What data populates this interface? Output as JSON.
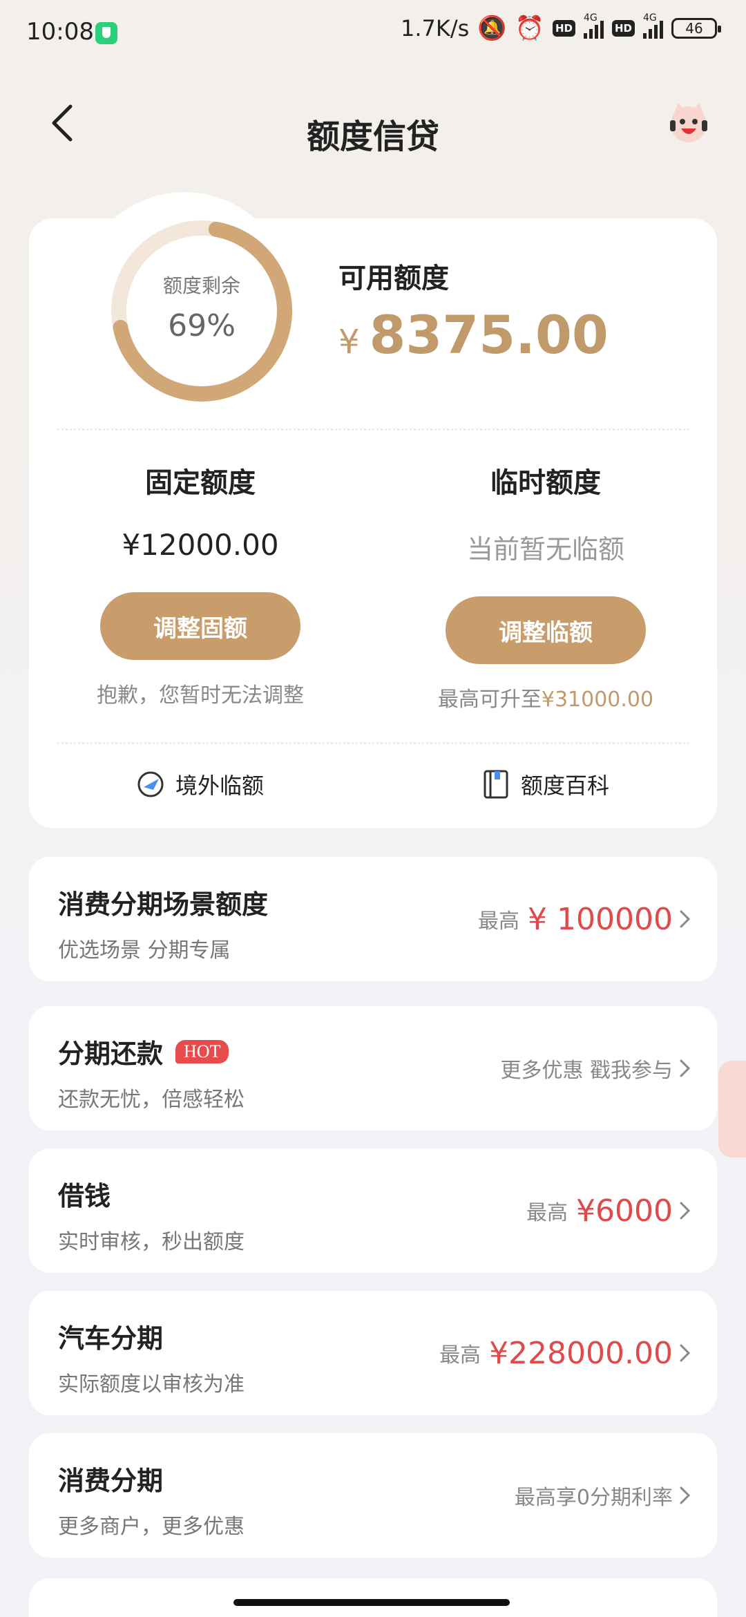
{
  "status_bar": {
    "time": "10:08",
    "net_speed": "1.7K/s",
    "hd1": "HD",
    "hd2": "HD",
    "network1": "4G",
    "network2": "4G",
    "battery": "46"
  },
  "header": {
    "title": "额度信贷"
  },
  "credit": {
    "ring_label": "额度剩余",
    "ring_percent": "69%",
    "remaining_fraction": 0.69,
    "available_label": "可用额度",
    "available_currency": "¥",
    "available_amount": "8375.00",
    "fixed": {
      "title": "固定额度",
      "value": "¥12000.00",
      "button": "调整固额",
      "note": "抱歉，您暂时无法调整"
    },
    "temp": {
      "title": "临时额度",
      "value": "当前暂无临额",
      "button": "调整临额",
      "note_prefix": "最高可升至",
      "note_amount": "¥31000.00"
    },
    "links": {
      "overseas": "境外临额",
      "wiki": "额度百科"
    }
  },
  "list": [
    {
      "title": "消费分期场景额度",
      "sub": "优选场景 分期专属",
      "prefix": "最高",
      "amount": "¥ 100000"
    },
    {
      "title": "分期还款",
      "badge": "HOT",
      "sub": "还款无忧，倍感轻松",
      "prefix": "更多优惠 戳我参与",
      "amount": ""
    },
    {
      "title": "借钱",
      "sub": "实时审核，秒出额度",
      "prefix": "最高",
      "amount": "¥6000"
    },
    {
      "title": "汽车分期",
      "sub": "实际额度以审核为准",
      "prefix": "最高",
      "amount": "¥228000.00"
    },
    {
      "title": "消费分期",
      "sub": "更多商户，更多优惠",
      "prefix": "最高享0分期利率",
      "amount": ""
    }
  ],
  "colors": {
    "gold": "#c19a6b",
    "button_gold": "#c99d6b",
    "red": "#e04a4a",
    "hot": "#e84b4b"
  }
}
